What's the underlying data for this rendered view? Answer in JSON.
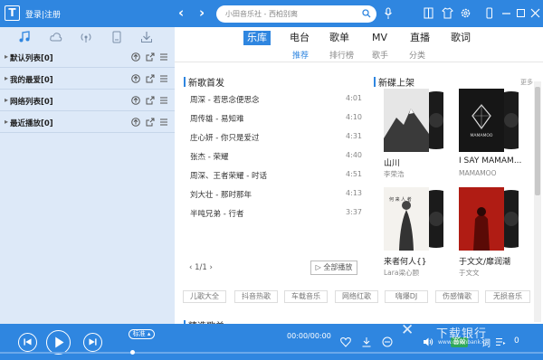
{
  "app": {
    "logo_letter": "T",
    "login_label": "登录|注册"
  },
  "nav": {
    "back": "‹",
    "forward": "›"
  },
  "search": {
    "placeholder": "小田音乐社 - 西柏别离"
  },
  "titlebar_icons": [
    "microphone-icon",
    "wardrobe-icon",
    "shirt-icon",
    "gear-icon",
    "phone-icon",
    "minimize-icon",
    "maximize-icon",
    "close-icon"
  ],
  "sidebar": {
    "tabs": [
      "music-note-icon",
      "cloud-icon",
      "radio-icon",
      "device-icon",
      "download-icon"
    ],
    "playlists": [
      {
        "label": "默认列表[0]"
      },
      {
        "label": "我的最爱[0]"
      },
      {
        "label": "网络列表[0]"
      },
      {
        "label": "最近播放[0]"
      }
    ]
  },
  "main": {
    "tabs": [
      "乐库",
      "电台",
      "歌单",
      "MV",
      "直播",
      "歌词"
    ],
    "subtabs": [
      "推荐",
      "排行榜",
      "歌手",
      "分类"
    ],
    "new_songs_title": "新歌首发",
    "new_albums_title": "新碟上架",
    "more_label": "更多",
    "songs": [
      {
        "name": "周深 - 若思念便思念",
        "time": "4:01"
      },
      {
        "name": "周传雄 - 易知难",
        "time": "4:10"
      },
      {
        "name": "庄心妍 - 你只是爱过",
        "time": "4:31"
      },
      {
        "name": "张杰 - 荣耀",
        "time": "4:40"
      },
      {
        "name": "周深、王者荣耀 - 时话",
        "time": "4:51"
      },
      {
        "name": "刘大壮 - 那时那年",
        "time": "4:13"
      },
      {
        "name": "半吨兄弟 - 行者",
        "time": "3:37"
      }
    ],
    "pager": "‹   1/1   ›",
    "play_all_label": "▷ 全部播放",
    "albums": [
      {
        "title": "山川",
        "artist": "李荣浩",
        "cover_color": "#e8e8e8",
        "cover_text": ""
      },
      {
        "title": "I SAY MAMAM...",
        "artist": "MAMAMOO",
        "cover_color": "#1a1a1a",
        "cover_text": "MAMAMOO"
      },
      {
        "title": "来者何人{}",
        "artist": "Lara梁心颐",
        "cover_color": "#f4f2ee",
        "cover_text": "何 来 人 者"
      },
      {
        "title": "于文文/靡润潮",
        "artist": "于文文",
        "cover_color": "#b01c14",
        "cover_text": ""
      }
    ],
    "tags": [
      "儿歌大全",
      "抖音热歌",
      "车载音乐",
      "网络红歌",
      "嗨爆DJ",
      "伤感情歌",
      "无损音乐"
    ],
    "bottom_title": "精选歌单"
  },
  "player": {
    "quality": "标准 ▴",
    "time": "00:00/00:00",
    "sound_label": "音效",
    "lyric_label": "词",
    "playlist_count": "0",
    "progress": 0.24
  },
  "watermark": {
    "main": "下载银行",
    "sub": "www.downbank.cn"
  }
}
